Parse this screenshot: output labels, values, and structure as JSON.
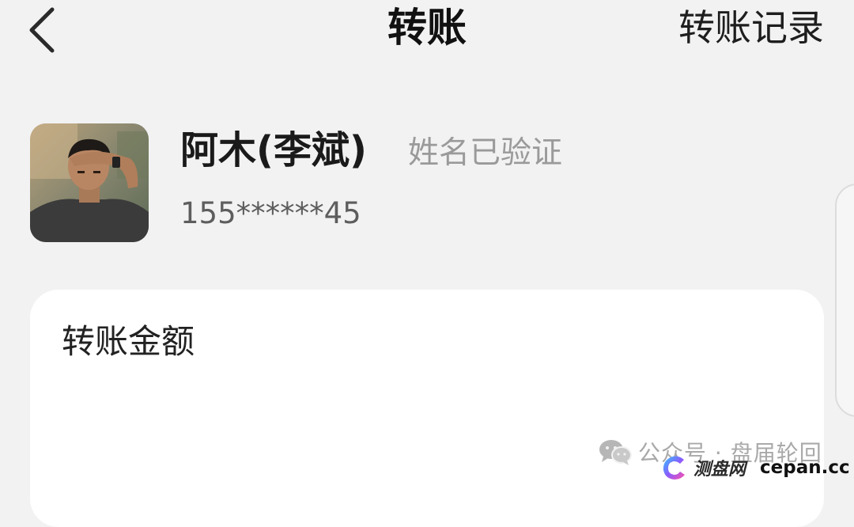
{
  "header": {
    "back_icon": "chevron-left-icon",
    "title": "转账",
    "history_label": "转账记录"
  },
  "payee": {
    "avatar_icon": "user-photo-avatar",
    "name": "阿木(李斌)",
    "verified_text": "姓名已验证",
    "phone": "155******45"
  },
  "amount_card": {
    "label": "转账金额"
  },
  "watermark": {
    "account_icon": "wechat-icon",
    "account_text": "公众号 · 盘届轮回",
    "site_icon": "cepan-logo",
    "site_name": "测盘网",
    "site_domain": "cepan.cc"
  },
  "colors": {
    "background": "#f2f2f2",
    "card": "#ffffff",
    "verified_gray": "#9a9a9a",
    "text_dark": "#1a1a1a"
  }
}
